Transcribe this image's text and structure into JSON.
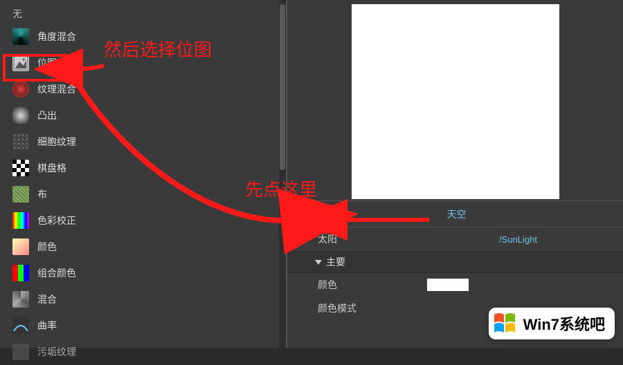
{
  "left": {
    "none": "无",
    "items": [
      {
        "label": "角度混合",
        "icon": "angle-blend"
      },
      {
        "label": "位图",
        "icon": "bitmap"
      },
      {
        "label": "纹理混合",
        "icon": "texture-blend"
      },
      {
        "label": "凸出",
        "icon": "bulge"
      },
      {
        "label": "细胞纹理",
        "icon": "cell"
      },
      {
        "label": "棋盘格",
        "icon": "checker"
      },
      {
        "label": "布",
        "icon": "cloth"
      },
      {
        "label": "色彩校正",
        "icon": "color-correct"
      },
      {
        "label": "颜色",
        "icon": "color"
      },
      {
        "label": "组合颜色",
        "icon": "combine-color"
      },
      {
        "label": "混合",
        "icon": "mix"
      },
      {
        "label": "曲率",
        "icon": "curvature"
      },
      {
        "label": "污垢纹理",
        "icon": "dirt"
      }
    ]
  },
  "right": {
    "hamburger": "menu",
    "sky": "天空",
    "sun_label": "太阳",
    "sun_value": "/SunLight",
    "main_section": "主要",
    "color_label": "颜色",
    "color_mode_label": "颜色模式"
  },
  "annotations": {
    "step1": "先点这里",
    "step2": "然后选择位图"
  },
  "watermark": {
    "text": "Win7系统吧"
  }
}
